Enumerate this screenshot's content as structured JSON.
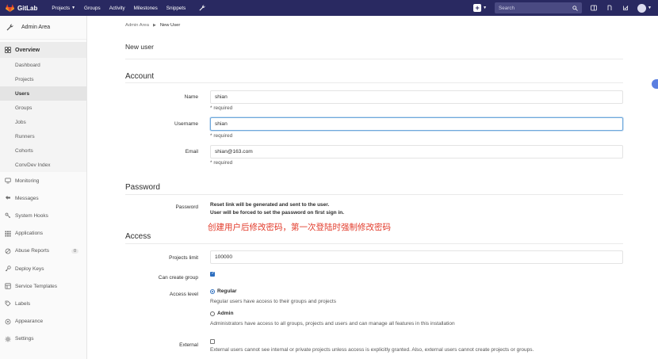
{
  "topbar": {
    "brand": "GitLab",
    "nav": [
      {
        "label": "Projects",
        "caret": true
      },
      {
        "label": "Groups"
      },
      {
        "label": "Activity"
      },
      {
        "label": "Milestones"
      },
      {
        "label": "Snippets"
      }
    ],
    "search_placeholder": "Search"
  },
  "sidebar": {
    "header": "Admin Area",
    "overview": "Overview",
    "overview_items": [
      "Dashboard",
      "Projects",
      "Users",
      "Groups",
      "Jobs",
      "Runners",
      "Cohorts",
      "ConvDev Index"
    ],
    "active_item": "Users",
    "items": [
      {
        "label": "Monitoring",
        "icon": "monitoring-icon"
      },
      {
        "label": "Messages",
        "icon": "messages-icon"
      },
      {
        "label": "System Hooks",
        "icon": "hooks-icon"
      },
      {
        "label": "Applications",
        "icon": "applications-icon"
      },
      {
        "label": "Abuse Reports",
        "icon": "abuse-icon",
        "badge": "0"
      },
      {
        "label": "Deploy Keys",
        "icon": "key-icon"
      },
      {
        "label": "Service Templates",
        "icon": "templates-icon"
      },
      {
        "label": "Labels",
        "icon": "labels-icon"
      },
      {
        "label": "Appearance",
        "icon": "appearance-icon"
      },
      {
        "label": "Settings",
        "icon": "gear-icon"
      }
    ]
  },
  "breadcrumb": {
    "parent": "Admin Area",
    "current": "New User"
  },
  "page_title": "New user",
  "account": {
    "heading": "Account",
    "name_label": "Name",
    "name_value": "shian",
    "username_label": "Username",
    "username_value": "shian",
    "email_label": "Email",
    "email_value": "shian@163.com",
    "required": "* required"
  },
  "password": {
    "heading": "Password",
    "label": "Password",
    "line1": "Reset link will be generated and sent to the user.",
    "line2": "User will be forced to set the password on first sign in."
  },
  "annotation": "创建用户后修改密码，第一次登陆时强制修改密码",
  "access": {
    "heading": "Access",
    "projects_limit_label": "Projects limit",
    "projects_limit_value": "100000",
    "can_create_group_label": "Can create group",
    "can_create_group": true,
    "access_level_label": "Access level",
    "regular_label": "Regular",
    "regular_help": "Regular users have access to their groups and projects",
    "admin_label": "Admin",
    "admin_help": "Administrators have access to all groups, projects and users and can manage all features in this installation",
    "selected_level": "Regular",
    "external_label": "External",
    "external_checked": false,
    "external_help": "External users cannot see internal or private projects unless access is explicitly granted. Also, external users cannot create projects or groups."
  }
}
